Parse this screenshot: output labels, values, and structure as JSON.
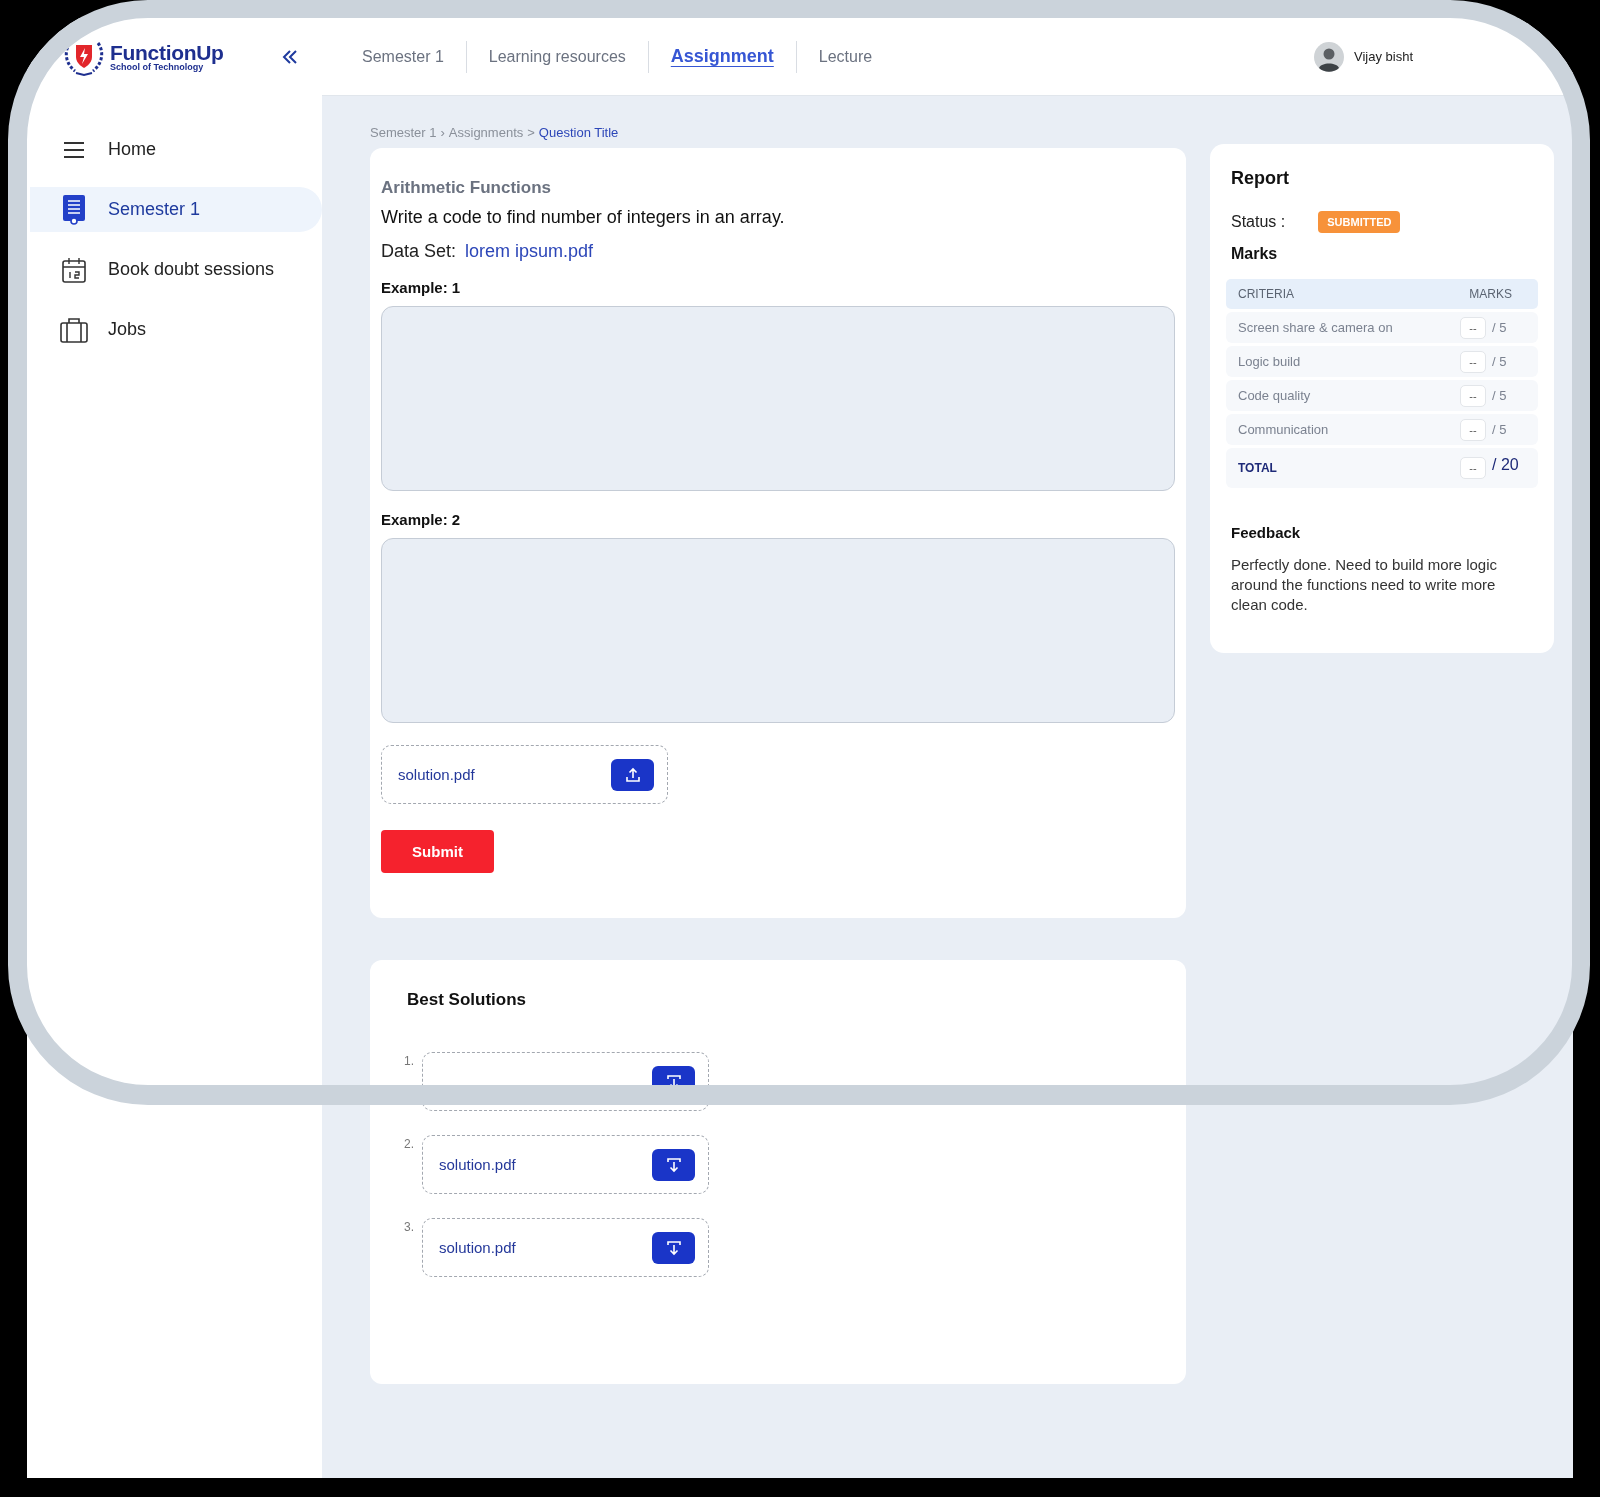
{
  "logo": {
    "name": "FunctionUp",
    "tagline": "School of Technology"
  },
  "sidebar": {
    "items": [
      {
        "label": "Home",
        "kind": "menu",
        "selected": false
      },
      {
        "label": "Semester 1",
        "kind": "document",
        "selected": true
      },
      {
        "label": "Book doubt sessions",
        "kind": "calendar",
        "selected": false
      },
      {
        "label": "Jobs",
        "kind": "briefcase",
        "selected": false
      }
    ]
  },
  "tabs": [
    {
      "label": "Semester 1",
      "selected": false
    },
    {
      "label": "Learning resources",
      "selected": false
    },
    {
      "label": "Assignment",
      "selected": true
    },
    {
      "label": "Lecture",
      "selected": false
    }
  ],
  "user": {
    "name": "Vijay bisht"
  },
  "breadcrumb": {
    "items": [
      "Semester 1",
      "Assignments",
      "Question Title"
    ],
    "separators": [
      "›",
      ">"
    ]
  },
  "assignment": {
    "title": "Arithmetic Functions",
    "question": "Write a code to find number of integers in an array.",
    "dataset_label": "Data Set:",
    "dataset_link": "lorem ipsum.pdf",
    "examples": [
      {
        "label": "Example: 1"
      },
      {
        "label": "Example: 2"
      }
    ],
    "upload": {
      "file": "solution.pdf"
    },
    "submit": "Submit"
  },
  "best_solutions": {
    "title": "Best Solutions",
    "items": [
      {
        "number": "1."
      },
      {
        "number": "2.",
        "file": "solution.pdf"
      },
      {
        "number": "3.",
        "file": "solution.pdf"
      }
    ]
  },
  "report": {
    "title": "Report",
    "status_label": "Status :",
    "status": "SUBMITTED",
    "marks_title": "Marks",
    "columns": [
      "CRITERIA",
      "MARKS"
    ],
    "rows": [
      {
        "criterion": "Screen share & camera on",
        "placeholder": "--",
        "max": "/ 5"
      },
      {
        "criterion": "Logic build",
        "placeholder": "--",
        "max": "/ 5"
      },
      {
        "criterion": "Code quality",
        "placeholder": "--",
        "max": "/ 5"
      },
      {
        "criterion": "Communication",
        "placeholder": "--",
        "max": "/ 5"
      }
    ],
    "total": {
      "label": "TOTAL",
      "placeholder": "--",
      "max": "/ 20"
    },
    "feedback_title": "Feedback",
    "feedback": "Perfectly done. Need to build more logic around the functions need to write more clean code."
  }
}
